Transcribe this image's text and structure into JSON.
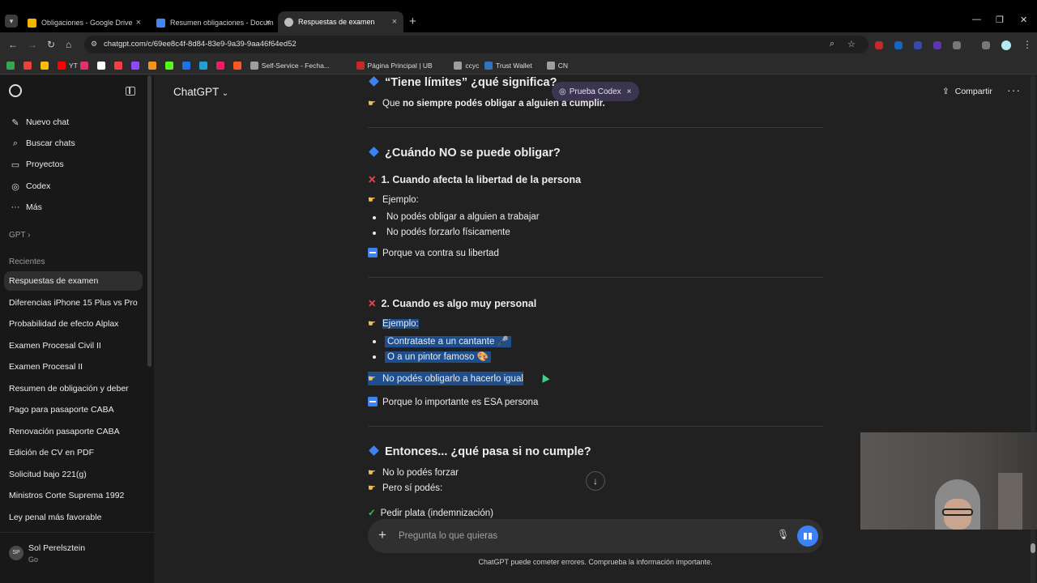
{
  "browser": {
    "tabs": [
      {
        "title": "Obligaciones - Google Drive",
        "active": false,
        "favicon_color": "#f4b400"
      },
      {
        "title": "Resumen obligaciones - Docum",
        "active": false,
        "favicon_color": "#4285f4"
      },
      {
        "title": "Respuestas de examen",
        "active": true,
        "favicon_color": "#bdbdbd"
      }
    ],
    "new_tab": "+",
    "url": "chatgpt.com/c/69ee8c4f-8d84-83e9-9a39-9aa46f64ed52",
    "bookmarks": [
      {
        "label": "",
        "color": "#34a853"
      },
      {
        "label": "",
        "color": "#ea4335"
      },
      {
        "label": "",
        "color": "#fbbc05"
      },
      {
        "label": "YT",
        "color": "#ff0000"
      },
      {
        "label": "",
        "color": "#e1306c"
      },
      {
        "label": "",
        "color": "#ffffff"
      },
      {
        "label": "",
        "color": "#fc3c44"
      },
      {
        "label": "",
        "color": "#9146ff"
      },
      {
        "label": "",
        "color": "#f7931a"
      },
      {
        "label": "",
        "color": "#53fc18"
      },
      {
        "label": "",
        "color": "#1a73e8"
      },
      {
        "label": "",
        "color": "#229ed9"
      },
      {
        "label": "",
        "color": "#e91e63"
      },
      {
        "label": "",
        "color": "#ff5722"
      },
      {
        "label": "Self-Service - Fecha...",
        "color": "#9e9e9e"
      },
      {
        "label": "Página Principal | UB",
        "color": "#c62828"
      },
      {
        "label": "ccyc",
        "color": "#9e9e9e"
      },
      {
        "label": "Trust Wallet",
        "color": "#3375bb"
      },
      {
        "label": "CN",
        "color": "#9e9e9e"
      }
    ]
  },
  "sidebar": {
    "nav": [
      {
        "icon": "new-chat-icon",
        "label": "Nuevo chat"
      },
      {
        "icon": "search-icon",
        "label": "Buscar chats"
      },
      {
        "icon": "folder-icon",
        "label": "Proyectos"
      },
      {
        "icon": "codex-icon",
        "label": "Codex"
      },
      {
        "icon": "more-icon",
        "label": "Más"
      }
    ],
    "gpt_label": "GPT",
    "recent_header": "Recientes",
    "chats": [
      "Respuestas de examen",
      "Diferencias iPhone 15 Plus vs Pro",
      "Probabilidad de efecto Alplax",
      "Examen Procesal Civil II",
      "Examen Procesal II",
      "Resumen de obligación y deber",
      "Pago para pasaporte CABA",
      "Renovación pasaporte CABA",
      "Edición de CV en PDF",
      "Solicitud bajo 221(g)",
      "Ministros Corte Suprema 1992",
      "Ley penal más favorable"
    ],
    "user": {
      "initials": "SP",
      "name": "Sol Perelsztein",
      "plan": "Go"
    }
  },
  "header": {
    "model": "ChatGPT",
    "codex_pill": "Prueba Codex",
    "share": "Compartir"
  },
  "content": {
    "limits_heading": "“Tiene límites” ¿qué significa?",
    "limits_line_pre": "Que ",
    "limits_line_bold": "no siempre podés obligar a alguien a cumplir.",
    "when_heading": "¿Cuándo NO se puede obligar?",
    "case1_title": "1. Cuando afecta la libertad de la persona",
    "case1_example": "Ejemplo:",
    "case1_bullets": [
      "No podés obligar a alguien a trabajar",
      "No podés forzarlo físicamente"
    ],
    "case1_reason": "Porque va contra su libertad",
    "case2_title": "2. Cuando es algo muy personal",
    "case2_example": "Ejemplo:",
    "case2_bullets": [
      "Contrataste a un cantante 🎤",
      "O a un pintor famoso 🎨"
    ],
    "case2_conclusion": "No podés obligarlo a hacerlo igual",
    "case2_reason": "Porque lo importante es ESA persona",
    "then_heading": "Entonces... ¿qué pasa si no cumple?",
    "then_lines": [
      "No lo podés forzar",
      "Pero sí podés:"
    ],
    "then_check": "Pedir plata (indemnización)"
  },
  "composer": {
    "placeholder": "Pregunta lo que quieras",
    "disclaimer": "ChatGPT puede cometer errores. Comprueba la información importante."
  }
}
